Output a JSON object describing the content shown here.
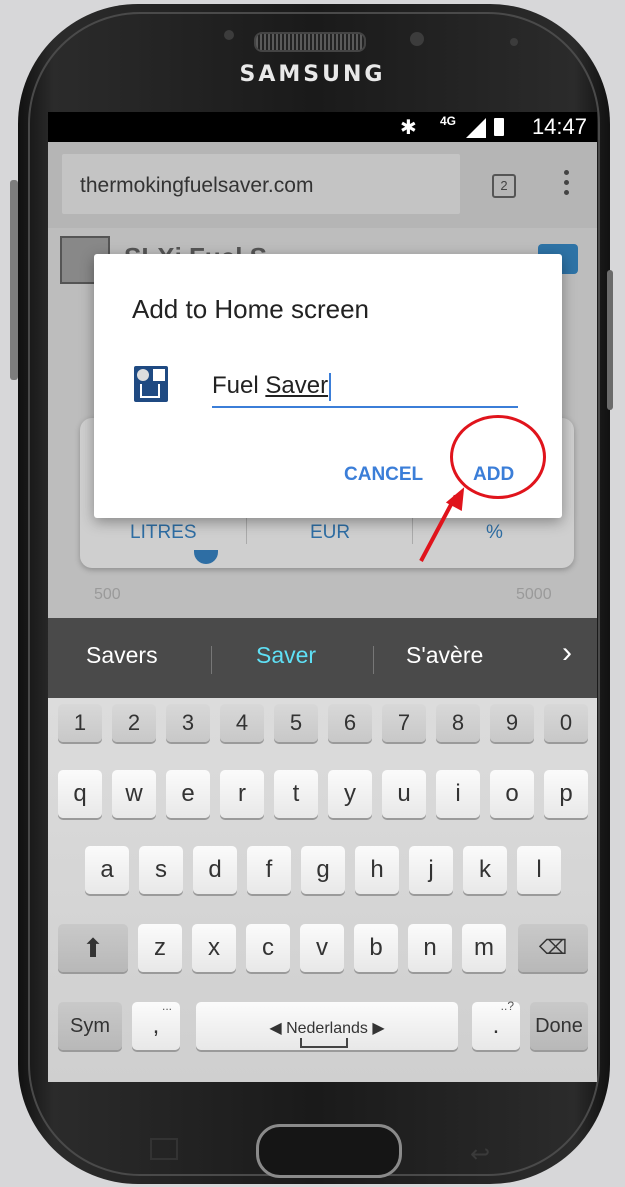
{
  "device": {
    "brand": "SAMSUNG"
  },
  "status_bar": {
    "time": "14:47",
    "network": "4G",
    "bluetooth_icon": "bluetooth-icon",
    "signal_icon": "signal-icon",
    "battery_icon": "battery-icon"
  },
  "browser": {
    "url": "thermokingfuelsaver.com",
    "tabs_count": "2",
    "menu_icon": "more-vert-icon"
  },
  "page": {
    "title": "SLXi Fuel S",
    "segments": [
      "LITRES",
      "EUR",
      "%"
    ],
    "range_min": "500",
    "range_max": "5000"
  },
  "dialog": {
    "title": "Add to Home screen",
    "input_prefix": "Fuel ",
    "input_underlined": "Saver",
    "cancel_label": "CANCEL",
    "add_label": "ADD"
  },
  "suggestions": {
    "items": [
      "Savers",
      "Saver",
      "S'avère"
    ],
    "active_index": 1
  },
  "keyboard": {
    "number_row": [
      "1",
      "2",
      "3",
      "4",
      "5",
      "6",
      "7",
      "8",
      "9",
      "0"
    ],
    "row1": [
      "q",
      "w",
      "e",
      "r",
      "t",
      "y",
      "u",
      "i",
      "o",
      "p"
    ],
    "row2": [
      "a",
      "s",
      "d",
      "f",
      "g",
      "h",
      "j",
      "k",
      "l"
    ],
    "row3": [
      "z",
      "x",
      "c",
      "v",
      "b",
      "n",
      "m"
    ],
    "sym_label": "Sym",
    "comma": ",",
    "comma_hint": "...",
    "space_label": "◀ Nederlands ▶",
    "period": ".",
    "period_hint": "..?",
    "done_label": "Done"
  },
  "colors": {
    "accent": "#3b7ed8",
    "annotation": "#e0141c",
    "suggest_active": "#5fe0f5"
  }
}
